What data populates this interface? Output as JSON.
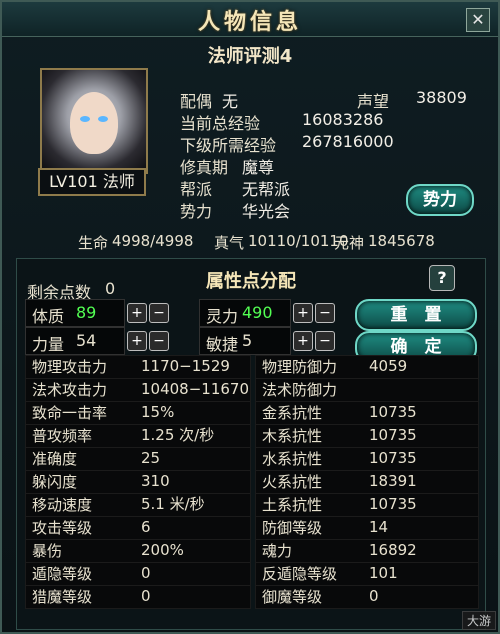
{
  "window": {
    "title": "人物信息",
    "subtitle": "法师评测4",
    "close_label": "✕"
  },
  "character": {
    "level_class": "LV101 法师",
    "spouse_label": "配偶",
    "spouse_value": "无",
    "reputation_label": "声望",
    "reputation_value": "38809",
    "total_exp_label": "当前总经验",
    "total_exp_value": "16083286",
    "next_exp_label": "下级所需经验",
    "next_exp_value": "267816000",
    "cultivation_label": "修真期",
    "cultivation_value": "魔尊",
    "guild_label": "帮派",
    "guild_value": "无帮派",
    "faction_label": "势力",
    "faction_value": "华光会",
    "faction_button": "势力"
  },
  "vitals": {
    "hp_label": "生命",
    "hp_value": "4998/4998",
    "mp_label": "真气",
    "mp_value": "10110/10110",
    "spirit_label": "元神",
    "spirit_value": "1845678"
  },
  "attributes": {
    "section_title": "属性点分配",
    "help_label": "?",
    "remaining_label": "剩余点数",
    "remaining_value": "0",
    "body_label": "体质",
    "body_value": "89",
    "strength_label": "力量",
    "strength_value": "54",
    "spirit_label": "灵力",
    "spirit_value": "490",
    "agility_label": "敏捷",
    "agility_value": "5",
    "plus": "+",
    "minus": "−",
    "reset_button": "重　置",
    "confirm_button": "确　定"
  },
  "stats": [
    {
      "left_label": "物理攻击力",
      "left_value": "1170−1529",
      "right_label": "物理防御力",
      "right_value": "4059"
    },
    {
      "left_label": "法术攻击力",
      "left_value": "10408−11670",
      "right_label": "法术防御力",
      "right_value": ""
    },
    {
      "left_label": "致命一击率",
      "left_value": "15%",
      "right_label": "金系抗性",
      "right_value": "10735"
    },
    {
      "left_label": "普攻频率",
      "left_value": "1.25 次/秒",
      "right_label": "木系抗性",
      "right_value": "10735"
    },
    {
      "left_label": "准确度",
      "left_value": "25",
      "right_label": "水系抗性",
      "right_value": "10735"
    },
    {
      "left_label": "躲闪度",
      "left_value": "310",
      "right_label": "火系抗性",
      "right_value": "18391"
    },
    {
      "left_label": "移动速度",
      "left_value": "5.1 米/秒",
      "right_label": "土系抗性",
      "right_value": "10735"
    },
    {
      "left_label": "攻击等级",
      "left_value": "6",
      "right_label": "防御等级",
      "right_value": "14"
    },
    {
      "left_label": "暴伤",
      "left_value": "200%",
      "right_label": "魂力",
      "right_value": "16892"
    },
    {
      "left_label": "遁隐等级",
      "left_value": "0",
      "right_label": "反遁隐等级",
      "right_value": "101"
    },
    {
      "left_label": "猎魔等级",
      "left_value": "0",
      "right_label": "御魔等级",
      "right_value": "0"
    }
  ]
}
